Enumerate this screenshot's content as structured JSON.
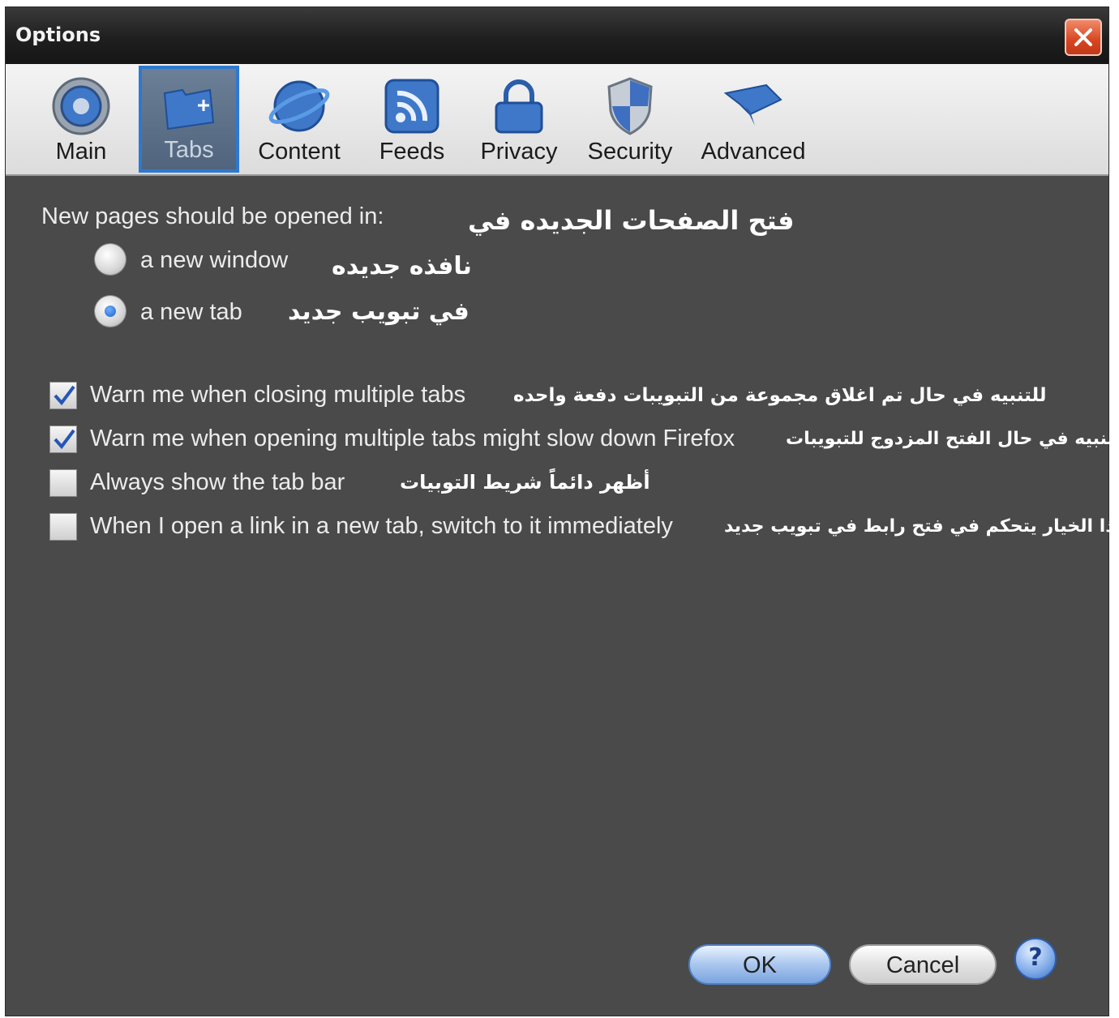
{
  "window": {
    "title": "Options"
  },
  "toolbar": {
    "panes": [
      {
        "label": "Main",
        "icon": "main-gear-icon"
      },
      {
        "label": "Tabs",
        "icon": "tabs-folder-icon",
        "selected": true
      },
      {
        "label": "Content",
        "icon": "content-globe-icon"
      },
      {
        "label": "Feeds",
        "icon": "feeds-rss-icon"
      },
      {
        "label": "Privacy",
        "icon": "privacy-lock-icon"
      },
      {
        "label": "Security",
        "icon": "security-shield-icon"
      },
      {
        "label": "Advanced",
        "icon": "advanced-icon"
      }
    ]
  },
  "tabs_pane": {
    "open_in_label": "New pages should be opened in:",
    "open_in_arabic": "فتح الصفحات الجديده في",
    "options": [
      {
        "label": "a new window",
        "arabic": "نافذه جديده",
        "selected": false
      },
      {
        "label": "a new tab",
        "arabic": "في تبويب جديد",
        "selected": true
      }
    ],
    "checkboxes": [
      {
        "label": "Warn me when closing multiple tabs",
        "arabic": "للتنبيه في حال تم اغلاق مجموعة من التبويبات دفعة واحده",
        "checked": true
      },
      {
        "label": "Warn me when opening multiple tabs might slow down Firefox",
        "arabic": "للتنبيه في حال الفتح المزدوج للتبويبات",
        "checked": true
      },
      {
        "label": "Always show the tab bar",
        "arabic": "أظهر دائماً شريط التوبيات",
        "checked": false
      },
      {
        "label": "When I open a link in a new tab, switch to it immediately",
        "arabic": "هذا الخيار يتحكم في فتح رابط في تبويب جديد",
        "checked": false
      }
    ]
  },
  "buttons": {
    "ok": "OK",
    "cancel": "Cancel",
    "help": "?"
  },
  "colors": {
    "background": "#4a4a4a",
    "selected_tab_border": "#2f78d0",
    "close_button": "#d8451f"
  }
}
